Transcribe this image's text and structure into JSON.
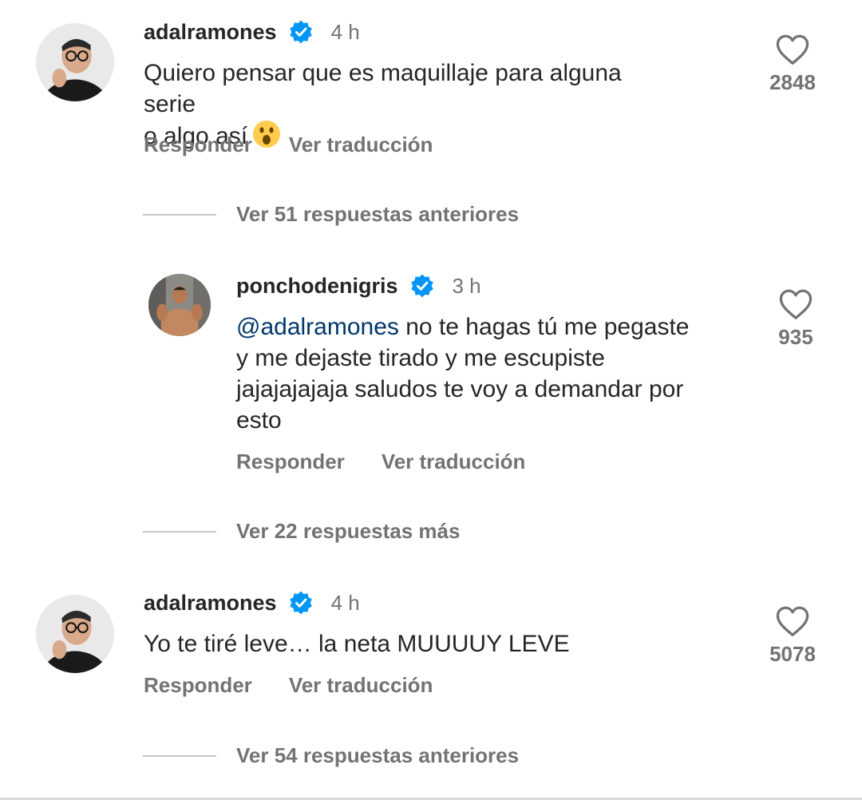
{
  "comments": [
    {
      "username": "adalramones",
      "time": "4 h",
      "text_lines": [
        "Quiero pensar que es maquillaje para alguna serie",
        "o algo así"
      ],
      "emoji": "astonished-face-emoji",
      "reply_label": "Responder",
      "translate_label": "Ver traducción",
      "likes": "2848"
    },
    {
      "username": "ponchodenigris",
      "time": "3 h",
      "mention": "@adalramones",
      "text_lines": [
        " no te hagas tú me pegaste",
        "y me dejaste tirado y me escupiste",
        "jajajajajaja saludos te voy a demandar por",
        "esto"
      ],
      "reply_label": "Responder",
      "translate_label": "Ver traducción",
      "likes": "935"
    },
    {
      "username": "adalramones",
      "time": "4 h",
      "text_lines": [
        "Yo te tiré leve… la neta MUUUUY LEVE"
      ],
      "reply_label": "Responder",
      "translate_label": "Ver traducción",
      "likes": "5078"
    }
  ],
  "reply_threads": [
    {
      "label": "Ver 51 respuestas anteriores"
    },
    {
      "label": "Ver 22 respuestas más"
    },
    {
      "label": "Ver 54 respuestas anteriores"
    }
  ],
  "colors": {
    "verified_badge": "#0095f6",
    "mention": "#00376b",
    "secondary_text": "#737373"
  }
}
